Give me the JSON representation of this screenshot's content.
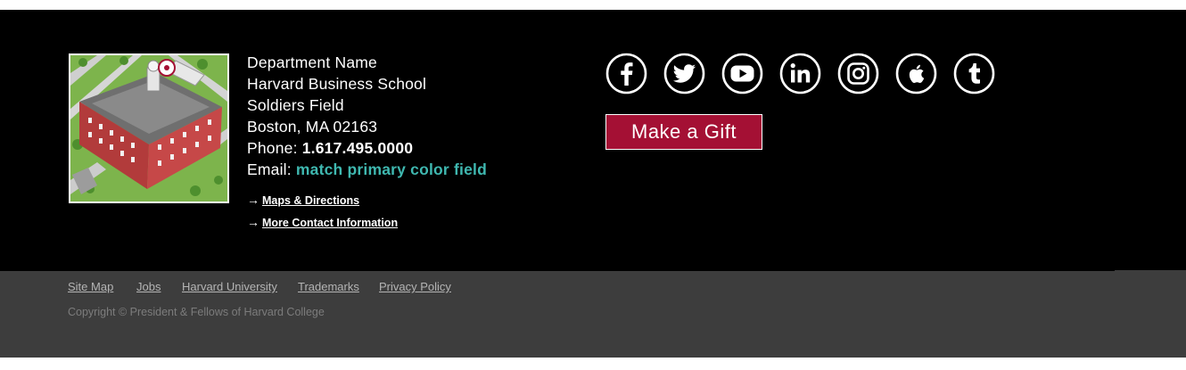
{
  "contact": {
    "department": "Department Name",
    "school": "Harvard Business School",
    "street": "Soldiers Field",
    "city": "Boston, MA 02163",
    "phone_label": "Phone: ",
    "phone": "1.617.495.0000",
    "email_label": "Email: ",
    "email": "match primary color field"
  },
  "links": {
    "arrow": "→",
    "maps": "Maps & Directions",
    "contact": "More Contact Information"
  },
  "social": [
    "facebook-icon",
    "twitter-icon",
    "youtube-icon",
    "linkedin-icon",
    "instagram-icon",
    "apple-icon",
    "tumblr-icon"
  ],
  "gift_button": "Make a Gift",
  "footer": {
    "links": [
      "Site Map",
      "Jobs",
      "Harvard University",
      "Trademarks",
      "Privacy Policy"
    ],
    "copyright": "Copyright © President & Fellows of Harvard College"
  },
  "colors": {
    "footer_bg": "#000000",
    "bottom_bg": "#3d3d3d",
    "accent": "#3fb8b0",
    "gift": "#a41034"
  }
}
